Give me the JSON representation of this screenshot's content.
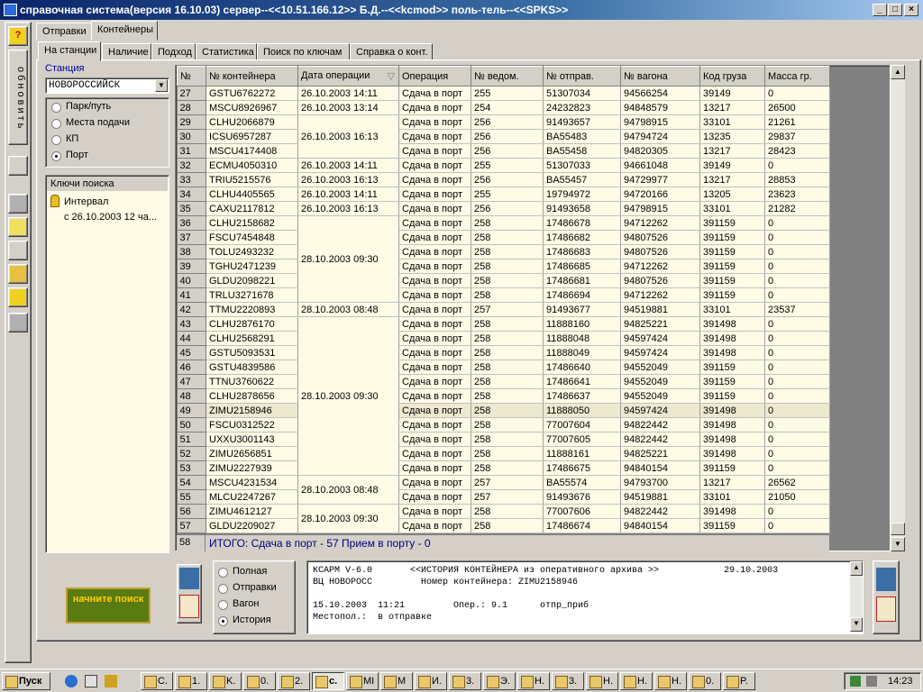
{
  "window": {
    "title": "справочная система(версия 16.10.03) сервер--<<10.51.166.12>> Б.Д.--<<kcmod>> поль-тель--<<SPKS>>"
  },
  "left_toolbar": {
    "help": "?",
    "refresh": "обновить"
  },
  "top_tabs": [
    "Отправки",
    "Контейнеры"
  ],
  "sub_tabs": [
    "На станции",
    "Наличие",
    "Подход",
    "Статистика",
    "Поиск по ключам",
    "Справка о конт."
  ],
  "filter": {
    "station_label": "Станция",
    "station_value": "НОВОРОССИЙСК",
    "options": [
      "Парк/путь",
      "Места подачи",
      "КП",
      "Порт"
    ],
    "selected": "Порт"
  },
  "search_keys": {
    "title": "Ключи поиска",
    "item": "Интервал",
    "sub": "с 26.10.2003   12 ча..."
  },
  "grid": {
    "columns": [
      "№",
      "№ контейнера",
      "Дата операции",
      "Операция",
      "№ ведом.",
      "№ отправ.",
      "№ вагона",
      "Код груза",
      "Масса гр."
    ],
    "rows": [
      [
        "27",
        "GSTU6762272",
        "26.10.2003  14:11",
        "Сдача в порт",
        "255",
        "51307034",
        "94566254",
        "39149",
        "0"
      ],
      [
        "28",
        "MSCU8926967",
        "26.10.2003  13:14",
        "Сдача в порт",
        "254",
        "24232823",
        "94848579",
        "13217",
        "26500"
      ],
      [
        "29",
        "CLHU2066879",
        "",
        "Сдача в порт",
        "256",
        "91493657",
        "94798915",
        "33101",
        "21261"
      ],
      [
        "30",
        "ICSU6957287",
        "26.10.2003  16:13",
        "Сдача в порт",
        "256",
        "BA55483",
        "94794724",
        "13235",
        "29837"
      ],
      [
        "31",
        "MSCU4174408",
        "",
        "Сдача в порт",
        "256",
        "BA55458",
        "94820305",
        "13217",
        "28423"
      ],
      [
        "32",
        "ECMU4050310",
        "26.10.2003  14:11",
        "Сдача в порт",
        "255",
        "51307033",
        "94661048",
        "39149",
        "0"
      ],
      [
        "33",
        "TRIU5215576",
        "26.10.2003  16:13",
        "Сдача в порт",
        "256",
        "BA55457",
        "94729977",
        "13217",
        "28853"
      ],
      [
        "34",
        "CLHU4405565",
        "26.10.2003  14:11",
        "Сдача в порт",
        "255",
        "19794972",
        "94720166",
        "13205",
        "23623"
      ],
      [
        "35",
        "CAXU2117812",
        "26.10.2003  16:13",
        "Сдача в порт",
        "256",
        "91493658",
        "94798915",
        "33101",
        "21282"
      ],
      [
        "36",
        "CLHU2158682",
        "",
        "Сдача в порт",
        "258",
        "17486678",
        "94712262",
        "391159",
        "0"
      ],
      [
        "37",
        "FSCU7454848",
        "",
        "Сдача в порт",
        "258",
        "17486682",
        "94807526",
        "391159",
        "0"
      ],
      [
        "38",
        "TOLU2493232",
        "28.10.2003  09:30",
        "Сдача в порт",
        "258",
        "17486683",
        "94807526",
        "391159",
        "0"
      ],
      [
        "39",
        "TGHU2471239",
        "",
        "Сдача в порт",
        "258",
        "17486685",
        "94712262",
        "391159",
        "0"
      ],
      [
        "40",
        "GLDU2098221",
        "",
        "Сдача в порт",
        "258",
        "17486681",
        "94807526",
        "391159",
        "0"
      ],
      [
        "41",
        "TRLU3271678",
        "",
        "Сдача в порт",
        "258",
        "17486694",
        "94712262",
        "391159",
        "0"
      ],
      [
        "42",
        "TTMU2220893",
        "28.10.2003  08:48",
        "Сдача в порт",
        "257",
        "91493677",
        "94519881",
        "33101",
        "23537"
      ],
      [
        "43",
        "CLHU2876170",
        "",
        "Сдача в порт",
        "258",
        "11888160",
        "94825221",
        "391498",
        "0"
      ],
      [
        "44",
        "CLHU2568291",
        "",
        "Сдача в порт",
        "258",
        "11888048",
        "94597424",
        "391498",
        "0"
      ],
      [
        "45",
        "GSTU5093531",
        "",
        "Сдача в порт",
        "258",
        "11888049",
        "94597424",
        "391498",
        "0"
      ],
      [
        "46",
        "GSTU4839586",
        "",
        "Сдача в порт",
        "258",
        "17486640",
        "94552049",
        "391159",
        "0"
      ],
      [
        "47",
        "TTNU3760622",
        "",
        "Сдача в порт",
        "258",
        "17486641",
        "94552049",
        "391159",
        "0"
      ],
      [
        "48",
        "CLHU2878656",
        "28.10.2003  09:30",
        "Сдача в порт",
        "258",
        "17486637",
        "94552049",
        "391159",
        "0"
      ],
      [
        "49",
        "ZIMU2158946",
        "",
        "Сдача в порт",
        "258",
        "11888050",
        "94597424",
        "391498",
        "0"
      ],
      [
        "50",
        "FSCU0312522",
        "",
        "Сдача в порт",
        "258",
        "77007604",
        "94822442",
        "391498",
        "0"
      ],
      [
        "51",
        "UXXU3001143",
        "",
        "Сдача в порт",
        "258",
        "77007605",
        "94822442",
        "391498",
        "0"
      ],
      [
        "52",
        "ZIMU2656851",
        "",
        "Сдача в порт",
        "258",
        "11888161",
        "94825221",
        "391498",
        "0"
      ],
      [
        "53",
        "ZIMU2227939",
        "",
        "Сдача в порт",
        "258",
        "17486675",
        "94840154",
        "391159",
        "0"
      ],
      [
        "54",
        "MSCU4231534",
        "28.10.2003  08:48",
        "Сдача в порт",
        "257",
        "BA55574",
        "94793700",
        "13217",
        "26562"
      ],
      [
        "55",
        "MLCU2247267",
        "",
        "Сдача в порт",
        "257",
        "91493676",
        "94519881",
        "33101",
        "21050"
      ],
      [
        "56",
        "ZIMU4612127",
        "28.10.2003  09:30",
        "Сдача в порт",
        "258",
        "77007606",
        "94822442",
        "391498",
        "0"
      ],
      [
        "57",
        "GLDU2209027",
        "",
        "Сдача в порт",
        "258",
        "17486674",
        "94840154",
        "391159",
        "0"
      ]
    ],
    "selected_row": "49",
    "total_row_num": "58",
    "total_text": "ИТОГО:  Сдача в порт - 57   Прием в порту - 0"
  },
  "bottom": {
    "start_button": "начните поиск",
    "modes": [
      "Полная",
      "Отправки",
      "Вагон",
      "История"
    ],
    "mode_selected": "История",
    "console_lines": [
      "КСАРМ V-6.0       <<ИСТОРИЯ КОНТЕЙНЕРА из оперативного архива >>            29.10.2003",
      "ВЦ НОВОРОСС         Номер контейнера: ZIMU2158946",
      "",
      "15.10.2003  11:21         Опер.: 9.1      отпр_приб",
      "Местопол.:  в отправке"
    ]
  },
  "taskbar": {
    "start": "Пуск",
    "buttons": [
      "С.",
      "1.",
      "K.",
      "0.",
      "2.",
      "c.",
      "MI",
      "M",
      "И.",
      "3.",
      "Э.",
      "H.",
      "3.",
      "H.",
      "H.",
      "H.",
      "0.",
      "P."
    ],
    "clock": "14:23"
  }
}
